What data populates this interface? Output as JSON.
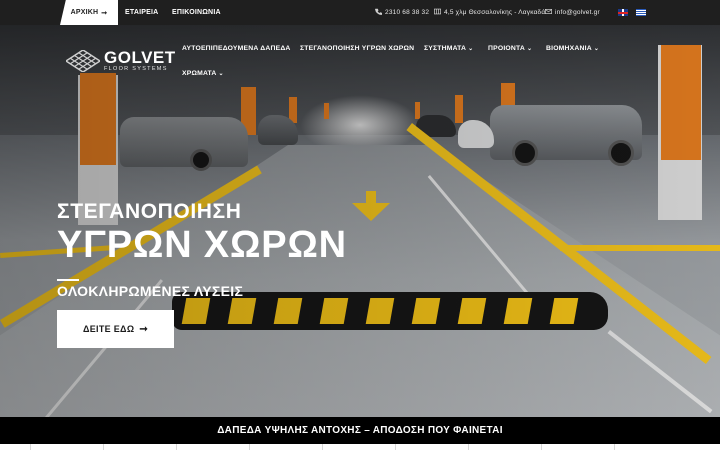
{
  "topbar": {
    "home_label": "ΑΡΧΙΚΗ",
    "home_arrow": "➞",
    "company_label": "ΕΤΑΙΡΕΙΑ",
    "contact_label": "ΕΠΙΚΟΙΝΩΝΙΑ",
    "phone": "2310 68 38 32",
    "address": "4,5 χλμ Θεσσαλονίκης - Λαγκαδά",
    "email": "info@golvet.gr",
    "phone_icon": "phone-icon",
    "address_icon": "map-icon",
    "email_icon": "envelope-icon"
  },
  "logo": {
    "name": "GOLVET",
    "subtitle": "FLOOR SYSTEMS"
  },
  "nav": {
    "items": [
      {
        "label": "ΑΥΤΟΕΠΙΠΕΔΟΥΜΕΝΑ ΔΑΠΕΔΑ",
        "has_dropdown": false
      },
      {
        "label": "ΣΤΕΓΑΝΟΠΟΙΗΣΗ ΥΓΡΩΝ ΧΩΡΩΝ",
        "has_dropdown": false
      },
      {
        "label": "ΣΥΣΤΗΜΑΤΑ",
        "has_dropdown": true
      },
      {
        "label": "ΠΡΟΙΟΝΤΑ",
        "has_dropdown": true
      },
      {
        "label": "ΒΙΟΜΗΧΑΝΙΑ",
        "has_dropdown": true
      },
      {
        "label": "ΧΡΩΜΑΤΑ",
        "has_dropdown": true
      }
    ],
    "chevron": "⌄"
  },
  "hero": {
    "line1": "ΣΤΕΓΑΝΟΠΟΙΗΣΗ",
    "line2": "ΥΓΡΩΝ ΧΩΡΩΝ",
    "line3": "ΟΛΟΚΛΗΡΩΜΕΝΕΣ ΛΥΣΕΙΣ",
    "cta_label": "ΔΕΙΤΕ ΕΔΩ",
    "cta_arrow": "➞"
  },
  "strip": {
    "text": "ΔΑΠΕΔΑ ΥΨΗΛΗΣ ΑΝΤΟΧΗΣ – ΑΠΟΔΟΣΗ ΠΟΥ ΦΑΙΝΕΤΑΙ"
  },
  "colors": {
    "topbar_bg": "#1f1f1f",
    "accent_yellow": "#f1c21b",
    "pillar_orange": "#e07a1f",
    "strip_bg": "#000000"
  }
}
